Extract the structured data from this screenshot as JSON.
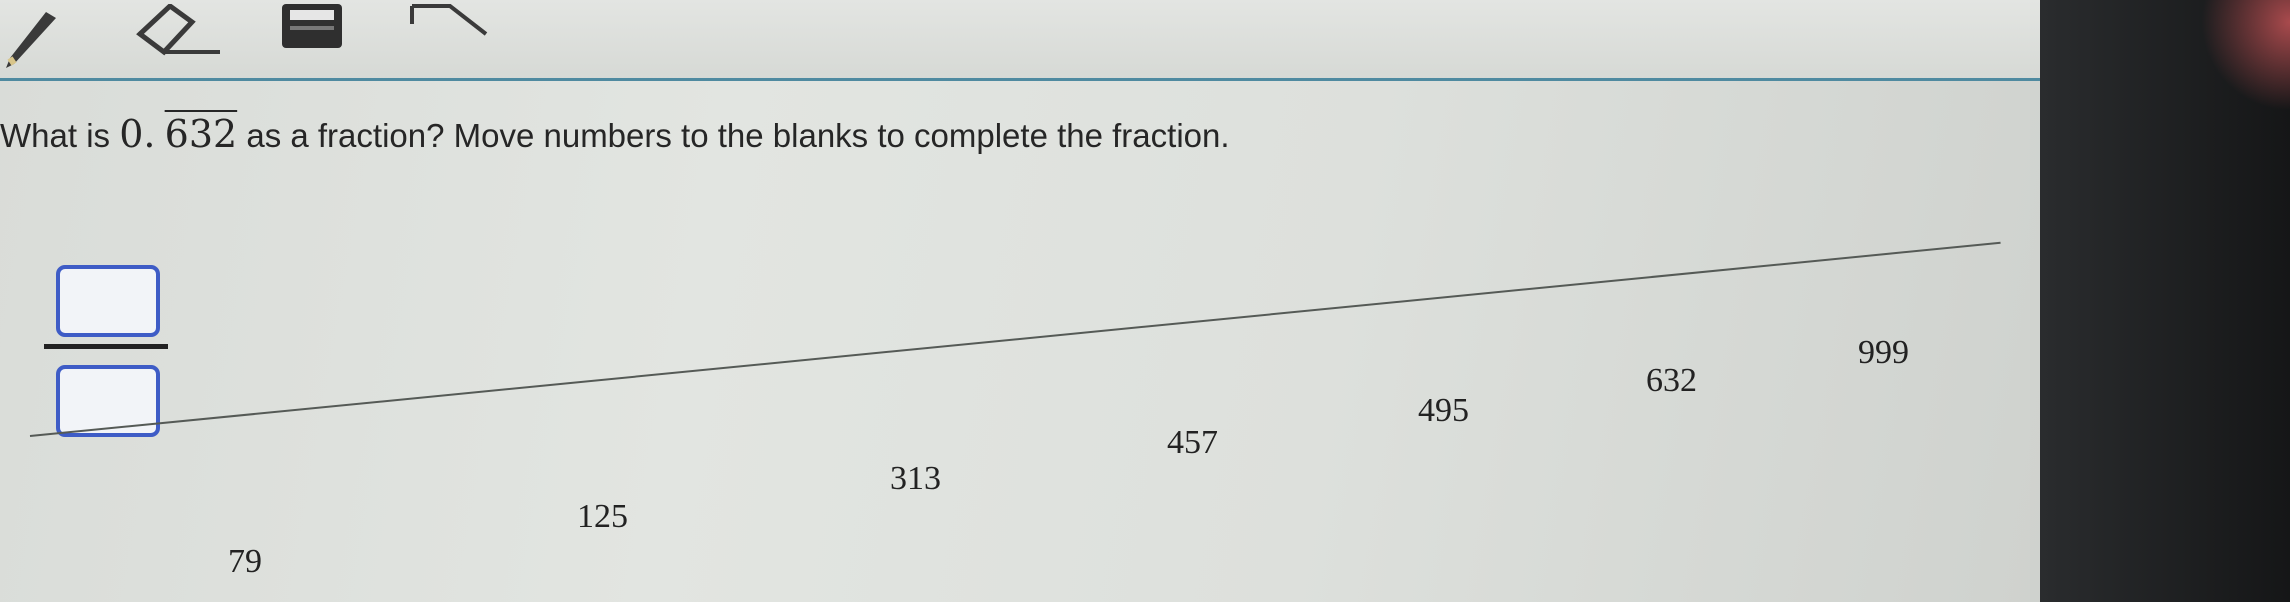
{
  "toolbar": {
    "tools": [
      "pencil-icon",
      "eraser-icon",
      "calculator-icon",
      "notepad-icon"
    ],
    "accent_color": "#4f8aa0"
  },
  "question": {
    "prefix": "What is ",
    "math_whole": "0.",
    "math_repeating": "632",
    "suffix": " as a fraction? Move numbers to the blanks to complete the fraction."
  },
  "answer": {
    "numerator": "",
    "denominator": "",
    "blank_border_color": "#3e5cc6"
  },
  "tiles": [
    "79",
    "125",
    "313",
    "457",
    "495",
    "632",
    "999"
  ]
}
